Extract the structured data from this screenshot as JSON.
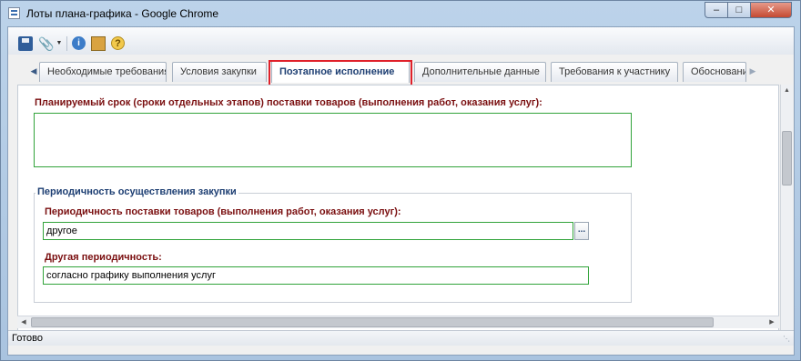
{
  "window": {
    "title": "Лоты плана-графика - Google Chrome",
    "minimize": "–",
    "maximize": "□",
    "close": "✕"
  },
  "toolbar": {
    "icons": [
      "save-icon",
      "attachment-icon",
      "info-icon",
      "exit-icon",
      "help-icon"
    ],
    "info_glyph": "i",
    "help_glyph": "?"
  },
  "tabs": [
    {
      "label": "Необходимые требования"
    },
    {
      "label": "Условия закупки"
    },
    {
      "label": "Поэтапное исполнение",
      "active": true
    },
    {
      "label": "Дополнительные данные"
    },
    {
      "label": "Требования к участнику"
    },
    {
      "label": "Обосновани"
    }
  ],
  "form": {
    "planned_term_label": "Планируемый срок (сроки отдельных этапов) поставки товаров (выполнения работ, оказания услуг):",
    "planned_term_value": "",
    "periodicity_group_title": "Периодичность осуществления закупки",
    "delivery_periodicity_label": "Периодичность поставки товаров (выполнения работ, оказания услуг):",
    "delivery_periodicity_value": "другое",
    "lookup_button": "...",
    "other_periodicity_label": "Другая периодичность:",
    "other_periodicity_value": "согласно графику выполнения услуг"
  },
  "status": {
    "text": "Готово"
  },
  "colors": {
    "label_red": "#7a0f10",
    "field_border": "#31a33a",
    "highlight": "#e0202a",
    "group_title": "#1e3f73"
  }
}
